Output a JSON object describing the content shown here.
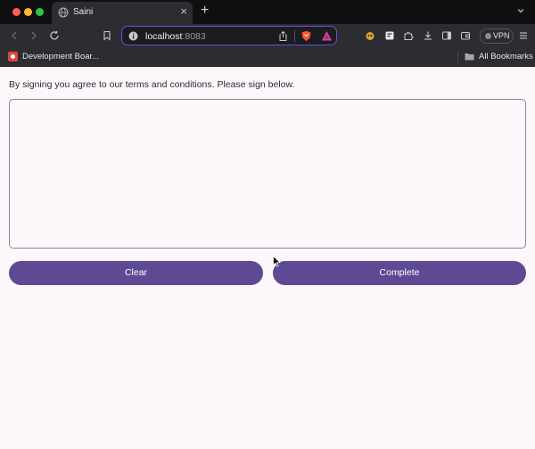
{
  "browser": {
    "tab": {
      "title": "Saini",
      "close_glyph": "×",
      "icon": "globe-icon"
    },
    "new_tab_glyph": "+",
    "url": {
      "host": "localhost",
      "port": ":8083"
    },
    "vpn_label": "VPN",
    "bookmarks": {
      "item_label": "Development Boar...",
      "all_label": "All Bookmarks"
    }
  },
  "page": {
    "instruction": "By signing you agree to our terms and conditions. Please sign below.",
    "buttons": {
      "clear_label": "Clear",
      "complete_label": "Complete"
    }
  },
  "colors": {
    "primary_button": "#5e4a94",
    "page_background": "#fdf7fb",
    "url_focus_border": "#6b4dd6"
  }
}
